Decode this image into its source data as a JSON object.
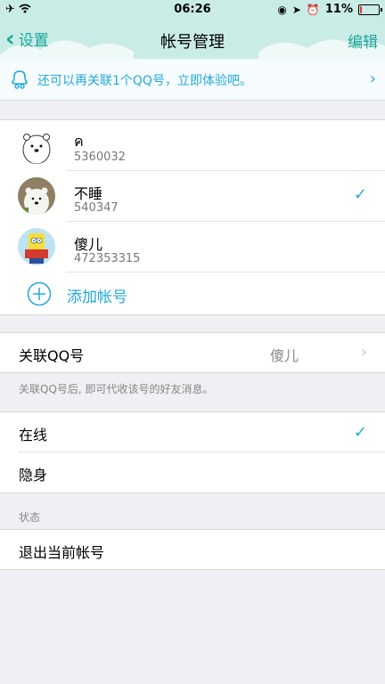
{
  "status_bar": {
    "time": "06:26",
    "battery": "11%",
    "battery_level": 0.11,
    "icons": [
      "airplane-icon",
      "wifi-icon",
      "lock-rotation-icon",
      "location-icon",
      "alarm-icon",
      "battery-icon"
    ]
  },
  "nav": {
    "back_label": "设置",
    "title": "帐号管理",
    "edit_label": "编辑"
  },
  "promo": {
    "text": "还可以再关联1个QQ号，立即体验吧。"
  },
  "accounts": [
    {
      "name": "ค",
      "qq": "5360032",
      "selected": false,
      "avatar": "polar-bear-avatar"
    },
    {
      "name": "不睡",
      "qq": "540347",
      "selected": true,
      "avatar": "ice-bear-avatar"
    },
    {
      "name": "傻儿",
      "qq": "472353315",
      "selected": false,
      "avatar": "spongebob-avatar"
    }
  ],
  "add_account_label": "添加帐号",
  "linked_qq": {
    "label": "关联QQ号",
    "value": "傻儿",
    "hint": "关联QQ号后, 即可代收该号的好友消息。"
  },
  "status_options": [
    {
      "label": "在线",
      "selected": true
    },
    {
      "label": "隐身",
      "selected": false
    }
  ],
  "status_caption": "状态",
  "logout_label": "退出当前帐号",
  "colors": {
    "accent": "#22aadd",
    "nav_tint": "#1aa59a",
    "nav_background": "#c9ece6",
    "page_background": "#efeff4"
  }
}
